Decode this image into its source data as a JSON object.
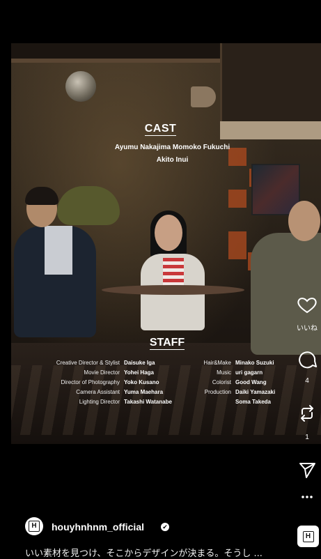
{
  "video": {
    "cast": {
      "title": "CAST",
      "line1": "Ayumu Nakajima   Momoko Fukuchi",
      "line2": "Akito Inui"
    },
    "staff": {
      "title": "STAFF",
      "left": [
        {
          "role": "Creative Director & Stylist",
          "name": "Daisuke Iga"
        },
        {
          "role": "Movie Director",
          "name": "Yohei Haga"
        },
        {
          "role": "Director of Photography",
          "name": "Yoko Kusano"
        },
        {
          "role": "Camera Assistant",
          "name": "Yuma Maehara"
        },
        {
          "role": "Lighting Director",
          "name": "Takashi Watanabe"
        }
      ],
      "right": [
        {
          "role": "Hair&Make",
          "name": "Minako Suzuki"
        },
        {
          "role": "Music",
          "name": "uri gagarn"
        },
        {
          "role": "Colorist",
          "name": "Good Wang"
        },
        {
          "role": "Production",
          "name": "Daiki Yamazaki"
        },
        {
          "role": "",
          "name": "Soma Takeda"
        }
      ]
    }
  },
  "actions": {
    "like_label": "いいね",
    "comment_count": "4",
    "repost_count": "1"
  },
  "account": {
    "avatar_letter": "H",
    "username": "houyhnhnm_official",
    "verified_mark": "✔"
  },
  "caption": "いい素材を見つけ、そこからデザインが決まる。そうし ...",
  "icons": {
    "like": "heart-icon",
    "comment": "comment-icon",
    "repost": "repost-icon",
    "share": "send-icon",
    "more": "more-icon",
    "audio": "audio-thumbnail"
  }
}
